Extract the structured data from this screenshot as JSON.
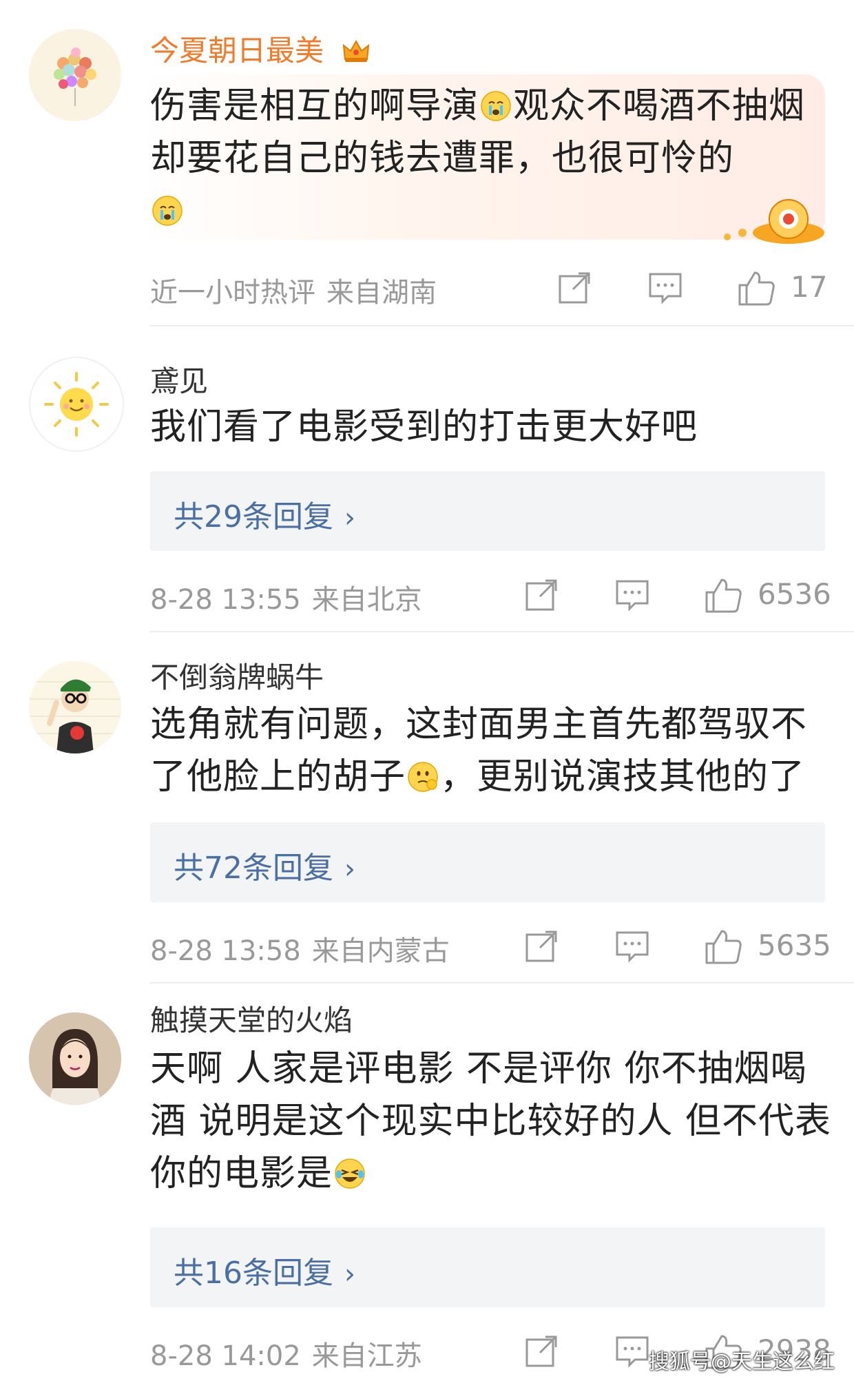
{
  "comments": [
    {
      "author": "今夏朝日最美",
      "text_parts": [
        "伤害是相互的啊导演",
        "观众不喝酒不抽烟却要花自己的钱去遭罪，也很可怜的"
      ],
      "meta_time": "近一小时热评",
      "meta_loc": "来自湖南",
      "likes": "17"
    },
    {
      "author": "鳶见",
      "text": "我们看了电影受到的打击更大好吧",
      "replies": "共29条回复",
      "meta_time": "8-28 13:55",
      "meta_loc": "来自北京",
      "likes": "6536"
    },
    {
      "author": "不倒翁牌蜗牛",
      "text_parts": [
        "选角就有问题，这封面男主首先都驾驭不了他脸上的胡子",
        "，更别说演技其他的了"
      ],
      "replies": "共72条回复",
      "meta_time": "8-28 13:58",
      "meta_loc": "来自内蒙古",
      "likes": "5635"
    },
    {
      "author": "触摸天堂的火焰",
      "text": "天啊 人家是评电影 不是评你 你不抽烟喝酒 说明是这个现实中比较好的人 但不代表你的电影是",
      "replies": "共16条回复",
      "meta_time": "8-28 14:02",
      "meta_loc": "来自江苏",
      "likes": "2938"
    }
  ],
  "icons": {
    "share": "share-icon",
    "comment": "comment-icon",
    "like": "thumbs-up-icon",
    "crown": "crown-icon",
    "chevron": "chevron-right-icon"
  },
  "colors": {
    "author_highlight": "#f07b2a",
    "reply_link": "#4a6fa5",
    "meta": "#999999"
  },
  "reply_chevron": "›",
  "watermark": "搜狐号@天生这么红"
}
